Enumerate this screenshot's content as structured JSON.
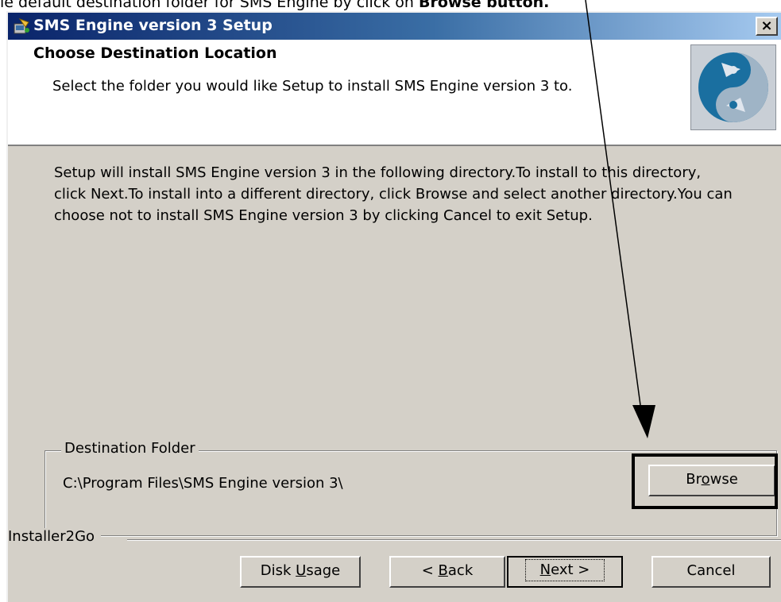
{
  "caption": {
    "prefix": "le default destination folder for SMS Engine by click on ",
    "bold": "Browse button."
  },
  "window": {
    "title": "SMS Engine version 3 Setup",
    "close_label": "×"
  },
  "header": {
    "title": "Choose Destination Location",
    "subtitle": "Select the folder you would like Setup to install SMS Engine version 3 to."
  },
  "body": {
    "text": "Setup will install SMS Engine version 3 in the following directory.To install to this directory, click Next.To install into a different directory, click Browse and select another directory.You can choose not to install SMS Engine version 3 by clicking Cancel to exit Setup."
  },
  "destination": {
    "legend": "Destination Folder",
    "path": "C:\\Program Files\\SMS Engine version 3\\"
  },
  "buttons": {
    "browse": {
      "pre": "Br",
      "mn": "o",
      "post": "wse"
    },
    "disk_usage": {
      "pre": "Disk ",
      "mn": "U",
      "post": "sage"
    },
    "back": {
      "pre": "< ",
      "mn": "B",
      "post": "ack"
    },
    "next": {
      "pre": "",
      "mn": "N",
      "post": "ext >"
    },
    "cancel": "Cancel"
  },
  "footer": {
    "brand": "Installer2Go"
  },
  "icons": {
    "app": "setup-app-icon",
    "logo": "yin-yang-arrows-logo"
  }
}
